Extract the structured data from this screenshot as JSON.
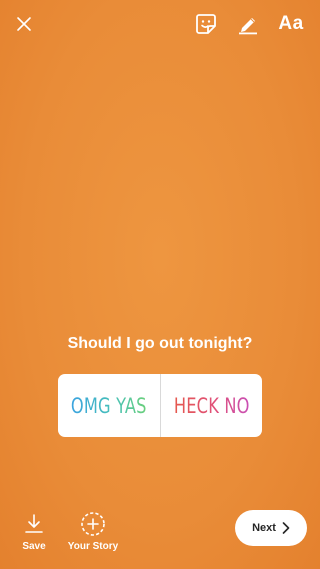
{
  "top_bar": {
    "close_icon": "close-icon",
    "sticker_icon": "sticker-icon",
    "draw_icon": "pen-icon",
    "text_tool_label": "Aa"
  },
  "poll": {
    "question": "Should I go out tonight?",
    "option_a": "OMG YAS",
    "option_b": "HECK NO"
  },
  "bottom_bar": {
    "save_label": "Save",
    "your_story_label": "Your Story",
    "next_label": "Next"
  },
  "colors": {
    "background": "#e98c38",
    "option_a_gradient": [
      "#3ba3e0",
      "#6cd07a"
    ],
    "option_b_gradient": [
      "#e5584e",
      "#c84fb6"
    ]
  }
}
